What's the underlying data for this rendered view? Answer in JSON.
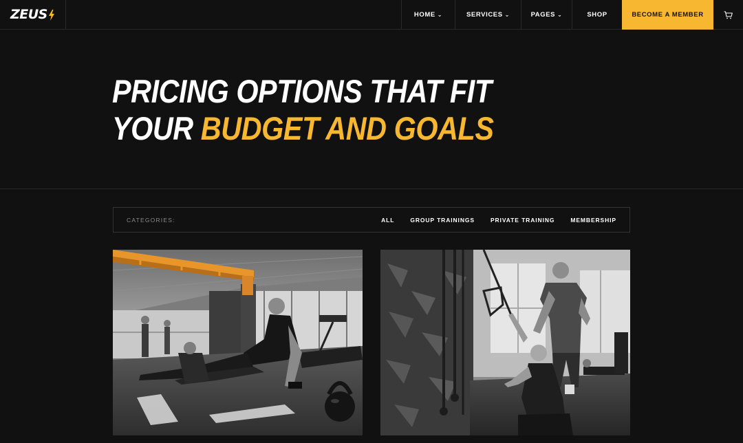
{
  "header": {
    "logo_text": "ZEUS",
    "logo_accent_color": "#f7b731",
    "nav": [
      {
        "label": "HOME",
        "dropdown": true
      },
      {
        "label": "SERVICES",
        "dropdown": true
      },
      {
        "label": "PAGES",
        "dropdown": true
      },
      {
        "label": "SHOP",
        "dropdown": false
      }
    ],
    "cta_label": "BECOME A MEMBER",
    "cart_icon": "cart-icon"
  },
  "hero": {
    "title_line1": "PRICING OPTIONS THAT FIT",
    "title_line2_white": "YOUR",
    "title_line2_accent": "BUDGET AND GOALS"
  },
  "filter": {
    "label": "CATEGORIES:",
    "items": [
      "ALL",
      "GROUP TRAININGS",
      "PRIVATE TRAINING",
      "MEMBERSHIP"
    ]
  },
  "cards": [
    {
      "image": "gym-floor-exercise-photo"
    },
    {
      "image": "trainer-cable-workout-photo"
    }
  ],
  "colors": {
    "background": "#111111",
    "accent": "#f7b731",
    "border": "#2a2a2a"
  }
}
